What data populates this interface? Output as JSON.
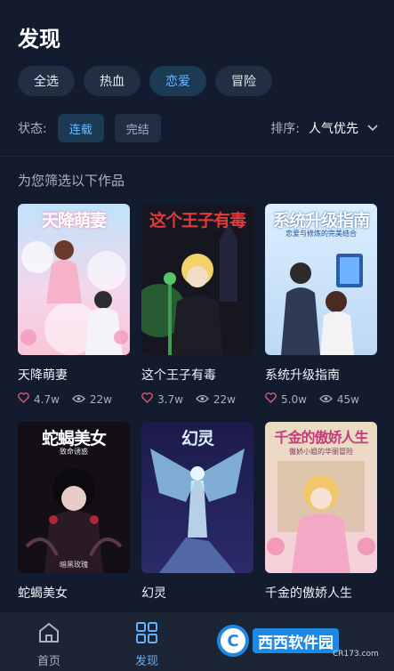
{
  "header": {
    "title": "发现"
  },
  "genres": [
    {
      "label": "全选",
      "active": false
    },
    {
      "label": "热血",
      "active": false
    },
    {
      "label": "恋爱",
      "active": true
    },
    {
      "label": "冒险",
      "active": false
    }
  ],
  "filters": {
    "status_label": "状态:",
    "status_options": [
      {
        "label": "连载",
        "active": true
      },
      {
        "label": "完结",
        "active": false
      }
    ],
    "sort_label": "排序:",
    "sort_value": "人气优先"
  },
  "section_title": "为您筛选以下作品",
  "books": [
    {
      "title": "天降萌妻",
      "cover_title": "天降萌妻",
      "cover_sub": "",
      "cover_foot": "",
      "likes": "4.7w",
      "views": "22w"
    },
    {
      "title": "这个王子有毒",
      "cover_title": "这个王子有毒",
      "cover_sub": "",
      "cover_foot": "",
      "likes": "3.7w",
      "views": "22w"
    },
    {
      "title": "系统升级指南",
      "cover_title": "系统升级指南",
      "cover_sub": "恋爱与修炼的完美结合",
      "cover_foot": "",
      "likes": "5.0w",
      "views": "45w"
    },
    {
      "title": "蛇蝎美女",
      "cover_title": "蛇蝎美女",
      "cover_sub": "致命诱惑",
      "cover_foot": "暗黑玫瑰",
      "likes": "",
      "views": ""
    },
    {
      "title": "幻灵",
      "cover_title": "幻灵",
      "cover_sub": "",
      "cover_foot": "",
      "likes": "",
      "views": ""
    },
    {
      "title": "千金的傲娇人生",
      "cover_title": "千金的傲娇人生",
      "cover_sub": "傲娇小姐的华丽冒险",
      "cover_foot": "",
      "likes": "",
      "views": ""
    }
  ],
  "tabbar": [
    {
      "label": "首页",
      "icon": "home-icon",
      "active": false
    },
    {
      "label": "发现",
      "icon": "grid-icon",
      "active": true
    }
  ],
  "watermark": {
    "text": "西西软件园",
    "sub": "CR173.com"
  },
  "colors": {
    "accent": "#5fb0ff",
    "background": "#121c2e",
    "like": "#e05a6e"
  }
}
